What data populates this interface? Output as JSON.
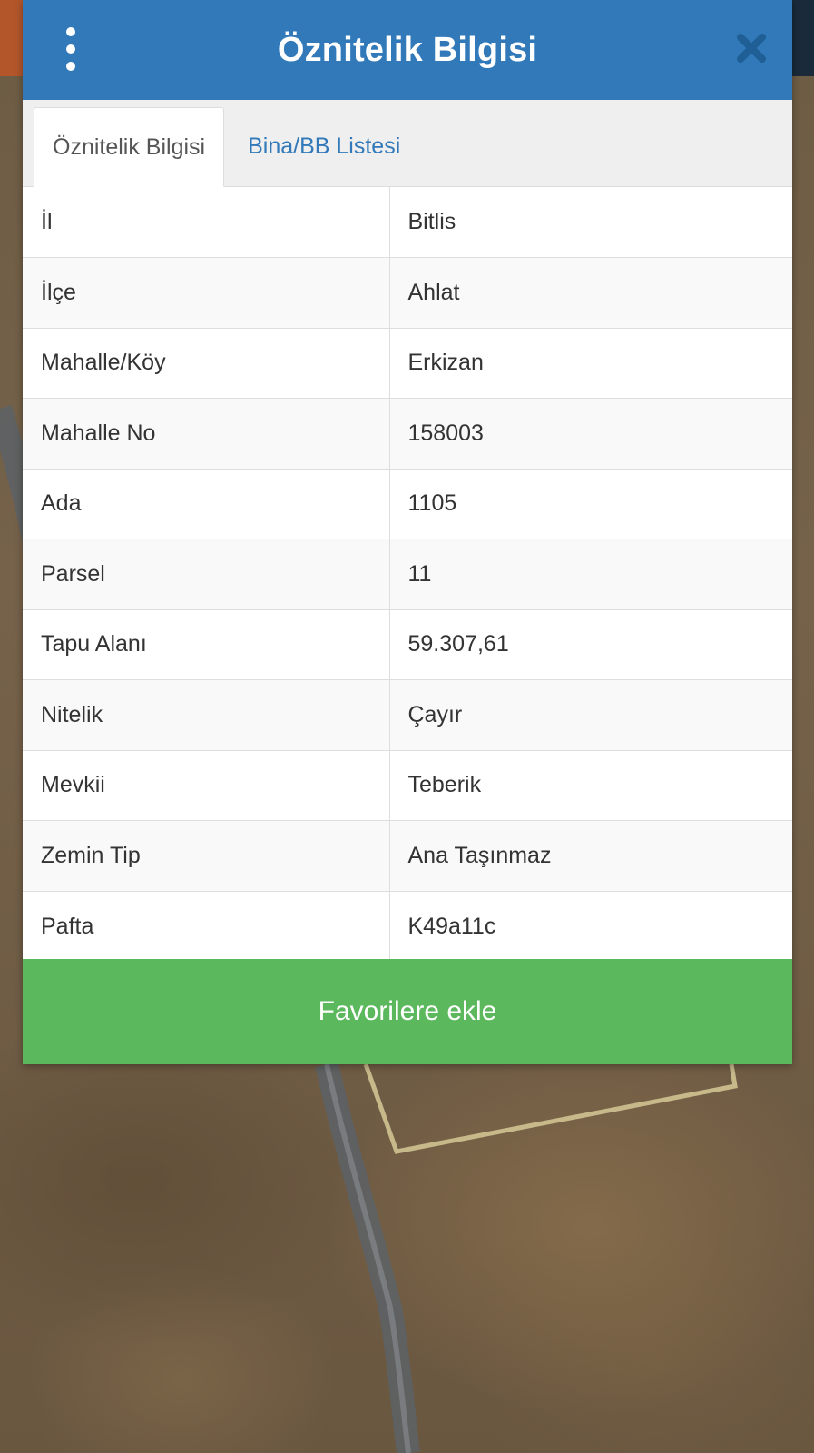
{
  "header": {
    "title": "Öznitelik Bilgisi",
    "color": "#3179b9"
  },
  "tabs": [
    {
      "label": "Öznitelik Bilgisi",
      "active": true
    },
    {
      "label": "Bina/BB Listesi",
      "active": false
    }
  ],
  "attributes": [
    {
      "key": "İl",
      "value": "Bitlis"
    },
    {
      "key": "İlçe",
      "value": "Ahlat"
    },
    {
      "key": "Mahalle/Köy",
      "value": "Erkizan"
    },
    {
      "key": "Mahalle No",
      "value": "158003"
    },
    {
      "key": "Ada",
      "value": "1105"
    },
    {
      "key": "Parsel",
      "value": "11"
    },
    {
      "key": "Tapu Alanı",
      "value": "59.307,61"
    },
    {
      "key": "Nitelik",
      "value": "Çayır"
    },
    {
      "key": "Mevkii",
      "value": "Teberik"
    },
    {
      "key": "Zemin Tip",
      "value": "Ana Taşınmaz"
    },
    {
      "key": "Pafta",
      "value": "K49a11c"
    }
  ],
  "favorite_button": {
    "label": "Favorilere ekle",
    "color": "#5cb85c"
  },
  "icons": {
    "menu": "vertical-dots-icon",
    "close": "close-icon"
  }
}
